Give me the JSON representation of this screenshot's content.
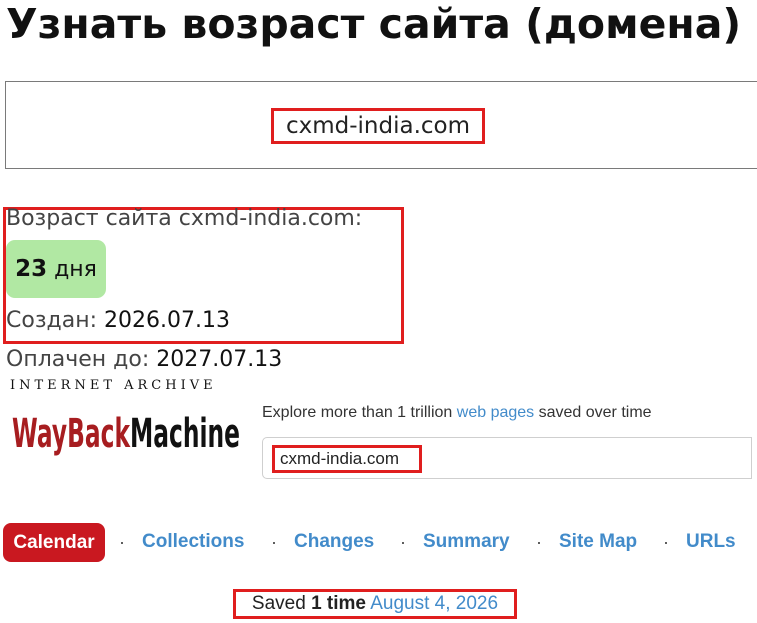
{
  "page": {
    "title": "Узнать возраст сайта (домена)",
    "domain_input_value": "cxmd-india.com"
  },
  "age": {
    "label": "Возраст сайта cxmd-india.com:",
    "days_number": "23",
    "days_unit": "дня",
    "created_label": "Создан:",
    "created_value": "2026.07.13",
    "paid_label": "Оплачен до:",
    "paid_value": "2027.07.13"
  },
  "wayback": {
    "logo_top": "INTERNET ARCHIVE",
    "logo_word1": "WayBack",
    "logo_word2": "Machine",
    "explore_prefix": "Explore more than 1 trillion",
    "explore_link": "web pages",
    "explore_suffix": "saved over time",
    "search_value": "cxmd-india.com",
    "nav": {
      "calendar": "Calendar",
      "collections": "Collections",
      "changes": "Changes",
      "summary": "Summary",
      "site_map": "Site Map",
      "urls": "URLs",
      "separator": "·"
    },
    "saved_prefix": "Saved",
    "saved_count": "1 time",
    "saved_date": "August 4, 2026"
  },
  "colors": {
    "highlight_border": "#e01e1e",
    "badge_bg": "#b1e8a3",
    "wayback_red": "#c91820",
    "link_blue": "#428bca"
  }
}
